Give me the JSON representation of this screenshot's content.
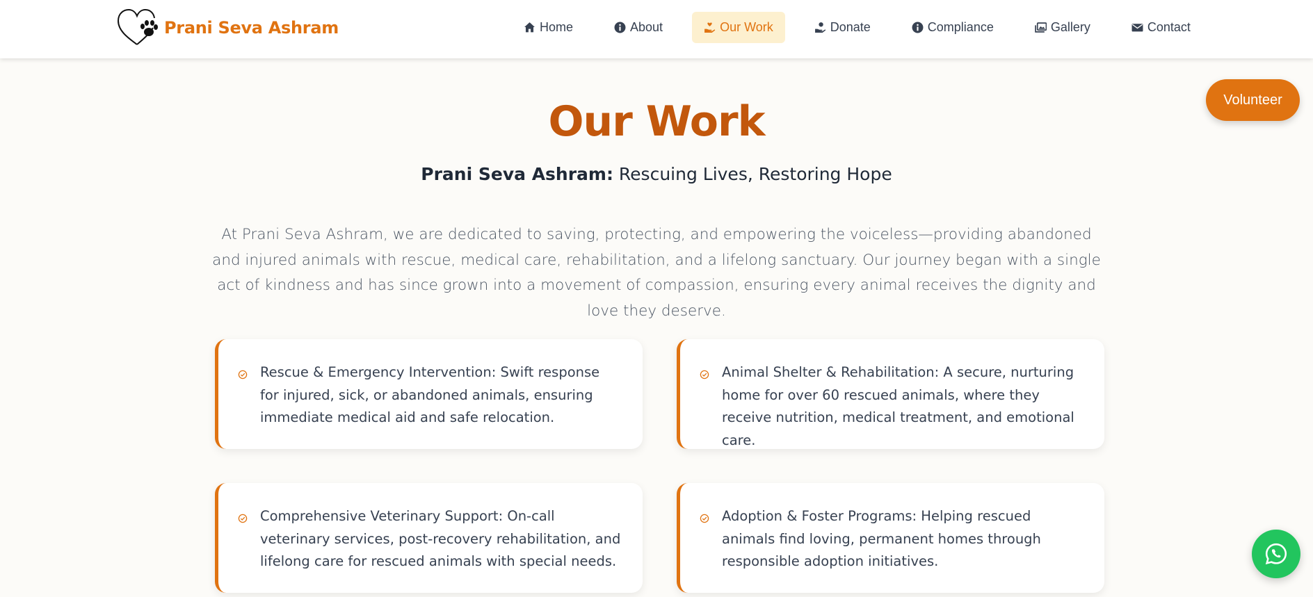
{
  "brand": {
    "name": "Prani Seva Ashram",
    "logo_icon": "heart-paw-icon",
    "accent_color": "#e07311"
  },
  "nav": {
    "items": [
      {
        "label": "Home",
        "icon": "home-icon",
        "active": false
      },
      {
        "label": "About",
        "icon": "info-icon",
        "active": false
      },
      {
        "label": "Our Work",
        "icon": "hand-heart-icon",
        "active": true
      },
      {
        "label": "Donate",
        "icon": "donate-icon",
        "active": false
      },
      {
        "label": "Compliance",
        "icon": "info-icon",
        "active": false
      },
      {
        "label": "Gallery",
        "icon": "images-icon",
        "active": false
      },
      {
        "label": "Contact",
        "icon": "envelope-icon",
        "active": false
      }
    ]
  },
  "floating": {
    "volunteer_label": "Volunteer",
    "whatsapp_icon": "whatsapp-icon"
  },
  "hero": {
    "title": "Our Work",
    "subtitle_bold": "Prani Seva Ashram:",
    "subtitle_rest": " Rescuing Lives, Restoring Hope",
    "intro": "At Prani Seva Ashram, we are dedicated to saving, protecting, and empowering the voiceless—providing abandoned and injured animals with rescue, medical care, rehabilitation, and a lifelong sanctuary. Our journey began with a single act of kindness and has since grown into a movement of compassion, ensuring every animal receives the dignity and love they deserve."
  },
  "cards": [
    {
      "text": "Rescue & Emergency Intervention: Swift response for injured, sick, or abandoned animals, ensuring immediate medical aid and safe relocation.",
      "icon": "check-circle-icon"
    },
    {
      "text": "Animal Shelter & Rehabilitation: A secure, nurturing home for over 60 rescued animals, where they receive nutrition, medical treatment, and emotional care.",
      "icon": "check-circle-icon"
    },
    {
      "text": "Comprehensive Veterinary Support: On-call veterinary services, post-recovery rehabilitation, and lifelong care for rescued animals with special needs.",
      "icon": "check-circle-icon"
    },
    {
      "text": "Adoption & Foster Programs: Helping rescued animals find loving, permanent homes through responsible adoption initiatives.",
      "icon": "check-circle-icon"
    }
  ]
}
